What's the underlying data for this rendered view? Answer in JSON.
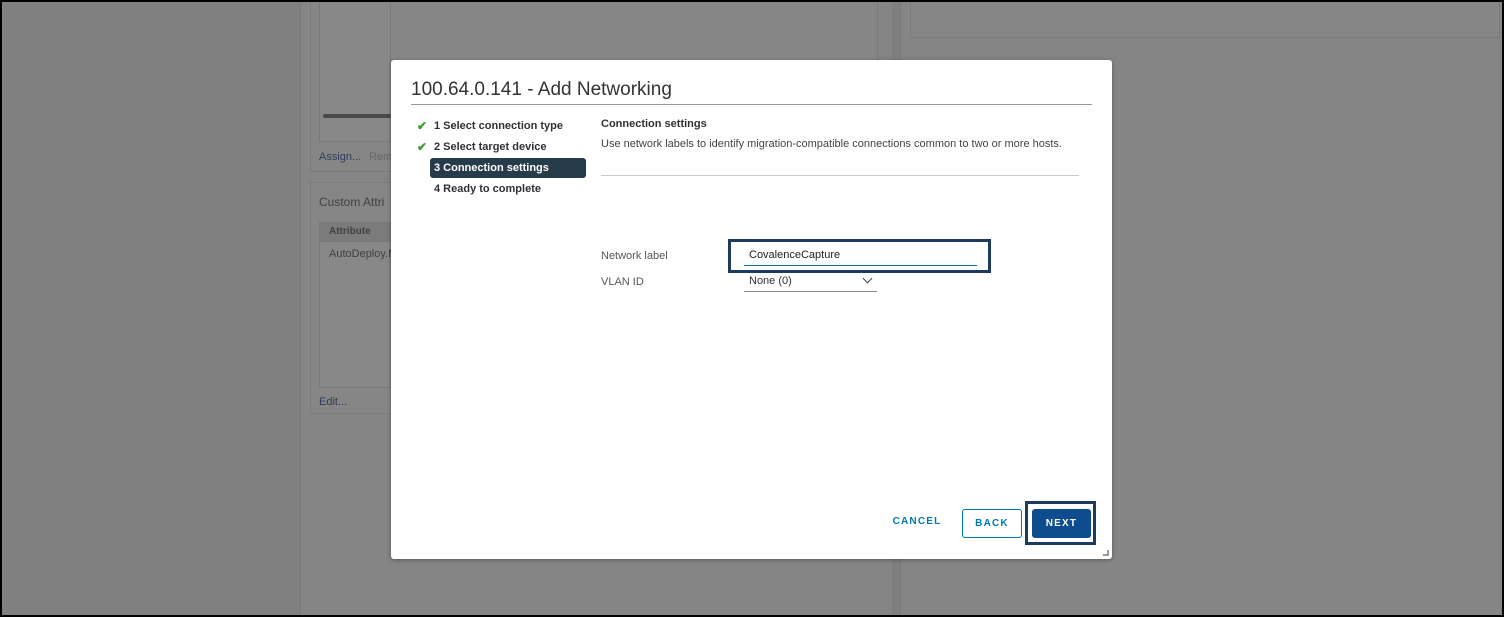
{
  "background": {
    "assign_link": "Assign...",
    "remove_link": "Rem",
    "custom_attributes_title": "Custom Attri",
    "attribute_header": "Attribute",
    "attribute_value": "AutoDeploy.M",
    "edit_link": "Edit..."
  },
  "modal": {
    "title": "100.64.0.141 - Add Networking",
    "steps": [
      {
        "label": "1 Select connection type",
        "state": "done"
      },
      {
        "label": "2 Select target device",
        "state": "done"
      },
      {
        "label": "3 Connection settings",
        "state": "active"
      },
      {
        "label": "4 Ready to complete",
        "state": "pending"
      }
    ],
    "check_glyph": "✔",
    "section_title": "Connection settings",
    "section_description": "Use network labels to identify migration-compatible connections common to two or more hosts.",
    "network_label": {
      "label": "Network label",
      "value": "CovalenceCapture"
    },
    "vlan_id": {
      "label": "VLAN ID",
      "selected": "None (0)"
    },
    "buttons": {
      "cancel": "CANCEL",
      "back": "BACK",
      "next": "NEXT"
    }
  },
  "colors": {
    "accent": "#0079b8",
    "primary_button": "#0d4d8f",
    "active_step": "#273c4b",
    "check": "#3b9b2f",
    "highlight_box": "#1d3b5f"
  }
}
